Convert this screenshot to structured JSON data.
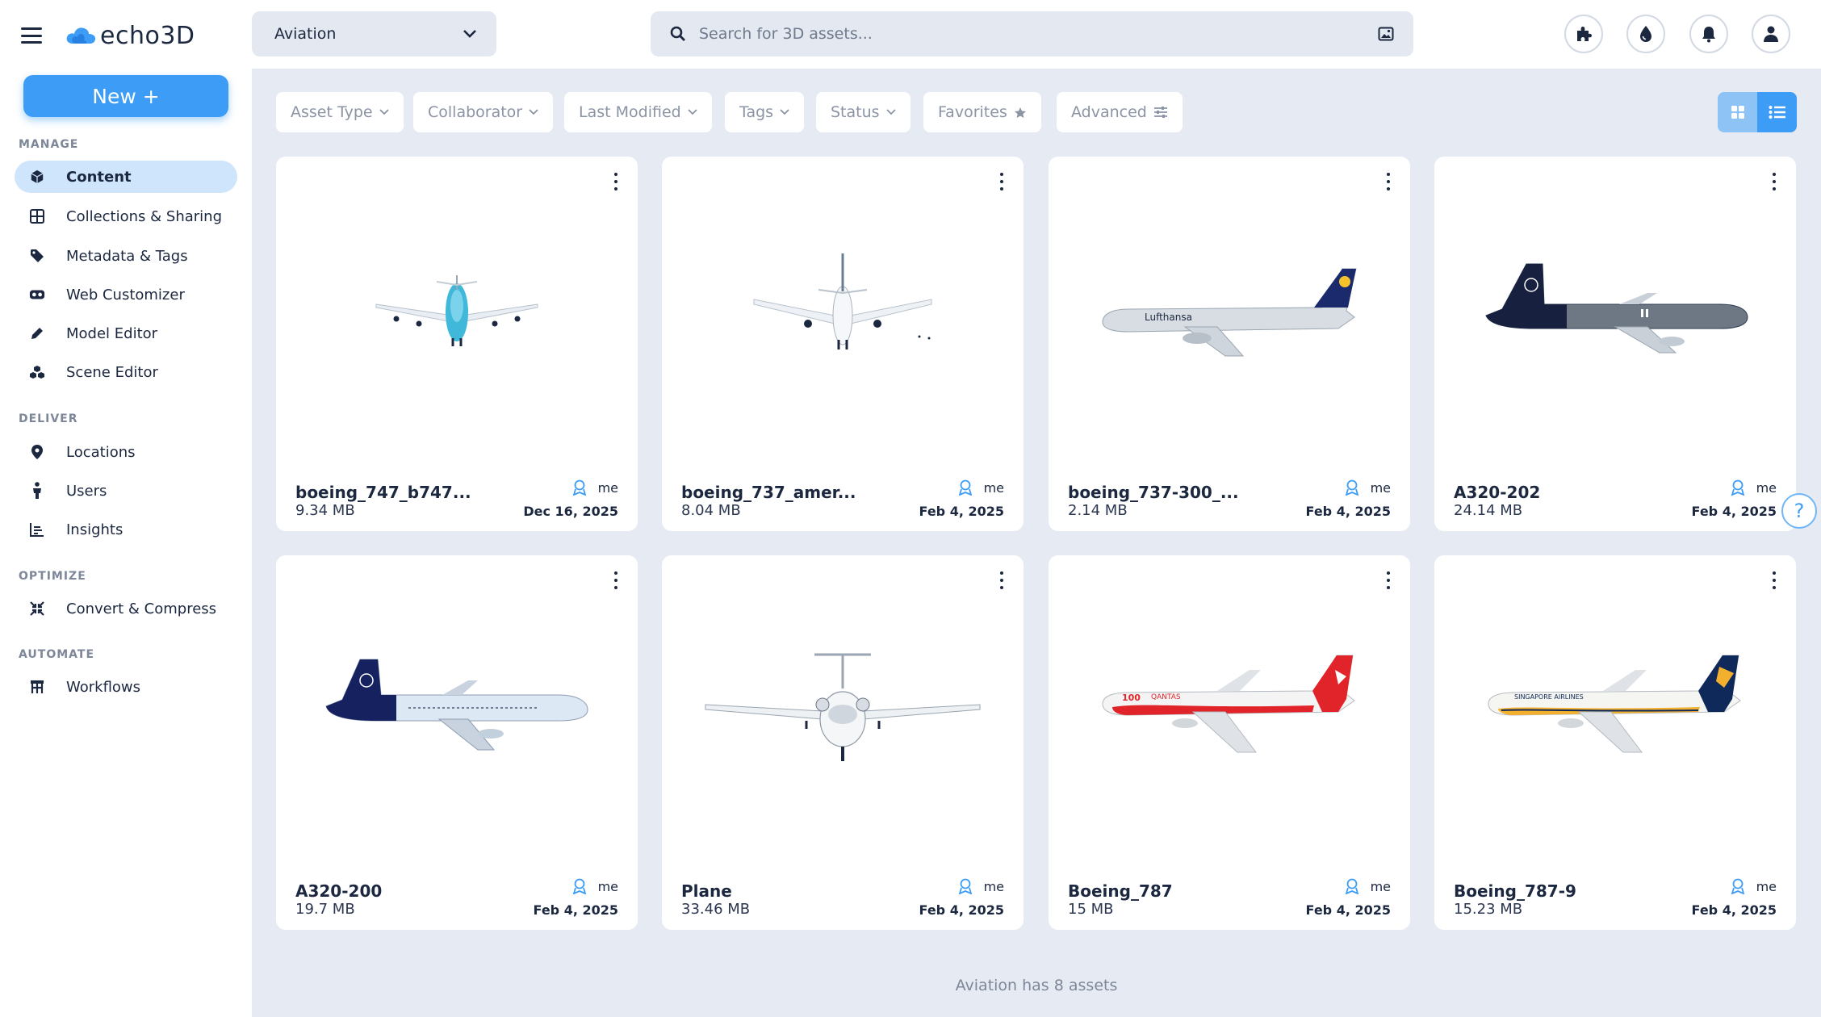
{
  "brand": {
    "name": "echo3D"
  },
  "sidebar": {
    "new_button": "New +",
    "sections": {
      "manage": "MANAGE",
      "deliver": "DELIVER",
      "optimize": "OPTIMIZE",
      "automate": "AUTOMATE"
    },
    "items": [
      {
        "label": "Content",
        "icon": "cube-icon",
        "active": true
      },
      {
        "label": "Collections & Sharing",
        "icon": "grid-icon"
      },
      {
        "label": "Metadata & Tags",
        "icon": "tag-icon"
      },
      {
        "label": "Web Customizer",
        "icon": "vr-headset-icon"
      },
      {
        "label": "Model Editor",
        "icon": "pencil-icon"
      },
      {
        "label": "Scene Editor",
        "icon": "cubes-icon"
      },
      {
        "label": "Locations",
        "icon": "map-pin-icon"
      },
      {
        "label": "Users",
        "icon": "person-icon"
      },
      {
        "label": "Insights",
        "icon": "chart-icon"
      },
      {
        "label": "Convert & Compress",
        "icon": "compress-icon"
      },
      {
        "label": "Workflows",
        "icon": "workflow-icon"
      }
    ]
  },
  "topbar": {
    "collection": "Aviation",
    "search_placeholder": "Search for 3D assets..."
  },
  "filters": {
    "asset_type": "Asset Type",
    "collaborator": "Collaborator",
    "last_modified": "Last Modified",
    "tags": "Tags",
    "status": "Status",
    "favorites": "Favorites",
    "advanced": "Advanced"
  },
  "assets": [
    {
      "name": "boeing_747_b747...",
      "size": "9.34 MB",
      "owner": "me",
      "date": "Dec 16, 2025",
      "thumb": "front-jumbo"
    },
    {
      "name": "boeing_737_amer...",
      "size": "8.04 MB",
      "owner": "me",
      "date": "Feb 4, 2025",
      "thumb": "front-narrow"
    },
    {
      "name": "boeing_737-300_...",
      "size": "2.14 MB",
      "owner": "me",
      "date": "Feb 4, 2025",
      "thumb": "side-lufthansa-grey"
    },
    {
      "name": "A320-202",
      "size": "24.14 MB",
      "owner": "me",
      "date": "Feb 4, 2025",
      "thumb": "side-dark"
    },
    {
      "name": "A320-200",
      "size": "19.7 MB",
      "owner": "me",
      "date": "Feb 4, 2025",
      "thumb": "side-navy-white"
    },
    {
      "name": "Plane",
      "size": "33.46 MB",
      "owner": "me",
      "date": "Feb 4, 2025",
      "thumb": "front-bizjet"
    },
    {
      "name": "Boeing_787",
      "size": "15 MB",
      "owner": "me",
      "date": "Feb 4, 2025",
      "thumb": "side-qantas"
    },
    {
      "name": "Boeing_787-9",
      "size": "15.23 MB",
      "owner": "me",
      "date": "Feb 4, 2025",
      "thumb": "side-singapore"
    }
  ],
  "footer": {
    "count_text": "Aviation has 8 assets"
  },
  "help": {
    "symbol": "?"
  },
  "colors": {
    "accent": "#3d9cf5",
    "accent_light": "#cfe5fb",
    "background": "#e6ebf3",
    "text": "#1c2840"
  }
}
